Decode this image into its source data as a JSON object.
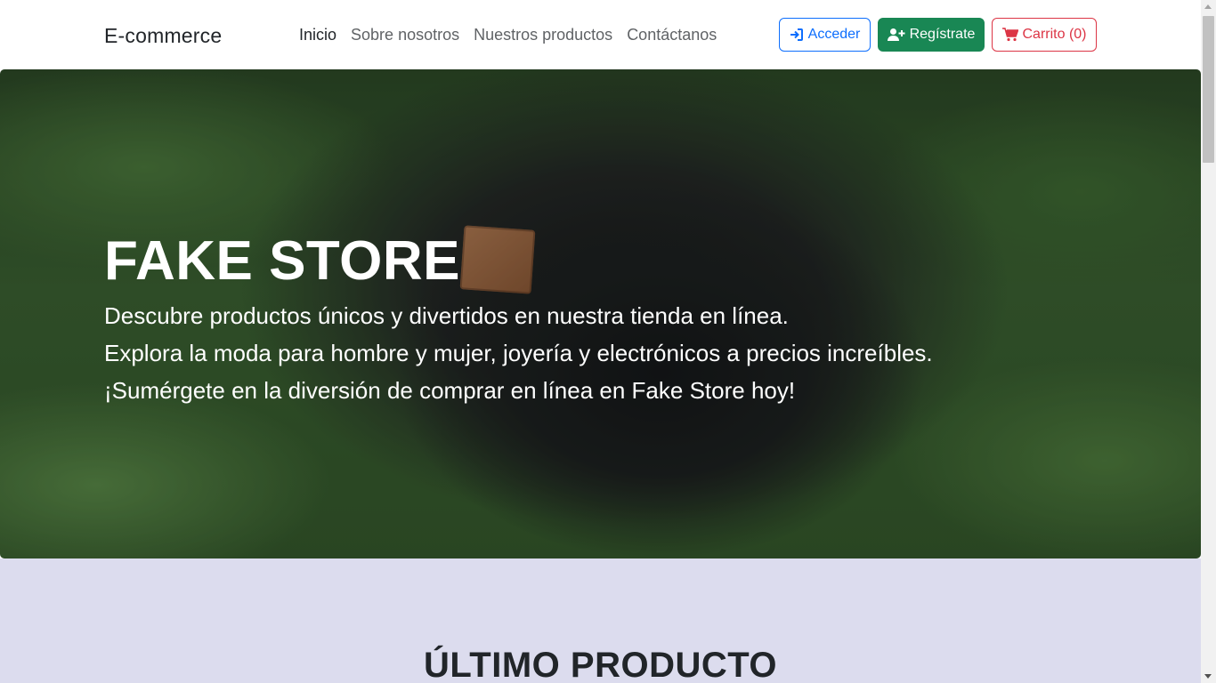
{
  "navbar": {
    "brand": "E-commerce",
    "links": [
      "Inicio",
      "Sobre nosotros",
      "Nuestros productos",
      "Contáctanos"
    ],
    "active_link": "Inicio",
    "login_label": "Acceder",
    "register_label": "Regístrate",
    "cart_label": "Carrito (0)"
  },
  "hero": {
    "title": "FAKE STORE",
    "lines": [
      "Descubre productos únicos y divertidos en nuestra tienda en línea.",
      "Explora la moda para hombre y mujer, joyería y electrónicos a precios increíbles.",
      "¡Sumérgete en la diversión de comprar en línea en Fake Store hoy!"
    ]
  },
  "section": {
    "title": "ÚLTIMO PRODUCTO"
  },
  "icons": {
    "login": "sign-in-icon",
    "register": "user-plus-icon",
    "cart": "cart-icon"
  },
  "colors": {
    "primary": "#0d6efd",
    "success": "#198754",
    "danger": "#dc3545",
    "section_bg": "#dcdcee"
  }
}
